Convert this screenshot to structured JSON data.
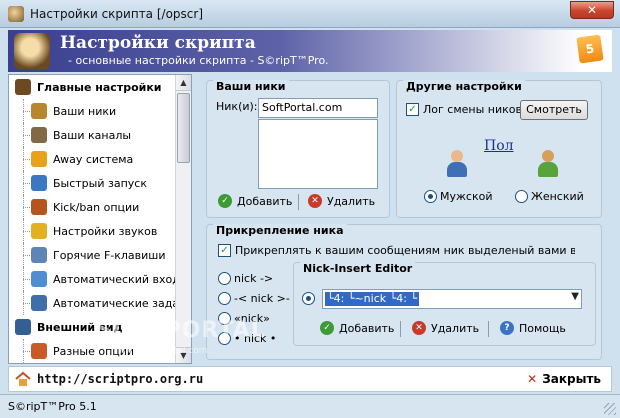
{
  "window": {
    "title": "Настройки скрипта [/opscr]",
    "close_glyph": "✕"
  },
  "header": {
    "title": "Настройки скрипта",
    "subtitle": "- основные настройки скрипта - S©ripT™Pro.",
    "badge": "5"
  },
  "sidebar": {
    "items": [
      {
        "label": "Главные настройки",
        "type": "group",
        "color": "#6b4a22"
      },
      {
        "label": "Ваши ники",
        "type": "child",
        "color": "#b8862e"
      },
      {
        "label": "Ваши каналы",
        "type": "child",
        "color": "#7f6a45"
      },
      {
        "label": "Away система",
        "type": "child",
        "color": "#e5a21a"
      },
      {
        "label": "Быстрый запуск",
        "type": "child",
        "color": "#3a78c2"
      },
      {
        "label": "Kick/ban опции",
        "type": "child",
        "color": "#b5541f"
      },
      {
        "label": "Настройки звуков",
        "type": "child",
        "color": "#e3b021"
      },
      {
        "label": "Горячие F-клавиши",
        "type": "child",
        "color": "#5d86b6"
      },
      {
        "label": "Автоматический вход",
        "type": "child",
        "color": "#4f8fd1"
      },
      {
        "label": "Автоматические задачи",
        "type": "child",
        "color": "#3e6fa8"
      },
      {
        "label": "Внешний вид",
        "type": "group",
        "color": "#345f94"
      },
      {
        "label": "Разные опции",
        "type": "child",
        "color": "#c95a2a"
      }
    ]
  },
  "nicks_panel": {
    "title": "Ваши ники",
    "nick_label": "Ник(и):",
    "nick_value": "SoftPortal.com",
    "add_label": "Добавить",
    "delete_label": "Удалить"
  },
  "other_panel": {
    "title": "Другие настройки",
    "log_label": "Лог смены ников",
    "log_checked": true,
    "view_button": "Смотреть",
    "gender_title": "Пол",
    "male_label": "Мужской",
    "female_label": "Женский",
    "selected_gender": "male"
  },
  "attach_panel": {
    "title": "Прикрепление ника",
    "attach_label": "Прикреплять к вашим сообщениям ник выделеный вами в Nick List",
    "attach_checked": true,
    "options": [
      "nick ->",
      "-< nick >-",
      "«nick»",
      "• nick •"
    ],
    "editor_title": "Nick-Insert Editor",
    "editor_value": "└4: └~nick └4: └",
    "add_label": "Добавить",
    "delete_label": "Удалить",
    "help_label": "Помощь"
  },
  "bottom": {
    "url": "http://scriptpro.org.ru",
    "close_label": "Закрыть"
  },
  "status": {
    "text": "S©ripT™Pro 5.1"
  },
  "watermark": {
    "text": "SOFTPORTAL",
    "url": "www.softportal.com"
  }
}
